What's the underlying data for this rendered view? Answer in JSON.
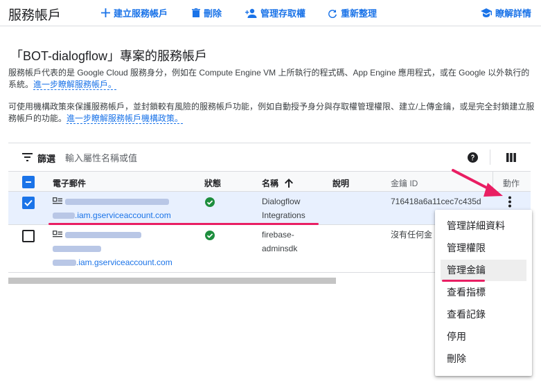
{
  "topbar": {
    "title": "服務帳戶",
    "create_label": "建立服務帳戶",
    "delete_label": "刪除",
    "manage_access_label": "管理存取權",
    "refresh_label": "重新整理",
    "learn_more_label": "瞭解詳情"
  },
  "section": {
    "title": "「BOT-dialogflow」專案的服務帳戶",
    "para1": "服務帳戶代表的是 Google Cloud 服務身分，例如在 Compute Engine VM 上所執行的程式碼、App Engine 應用程式，或在 Google 以外執行的系統。",
    "para1_link": "進一步瞭解服務帳戶。",
    "para2": "可使用機構政策來保護服務帳戶，並封鎖較有風險的服務帳戶功能，例如自動授予身分與存取權管理權限、建立/上傳金鑰，或是完全封鎖建立服務帳戶的功能。",
    "para2_link": "進一步瞭解服務帳戶機構政策。"
  },
  "filter": {
    "label": "篩選",
    "placeholder": "輸入屬性名稱或值"
  },
  "table": {
    "headers": {
      "email": "電子郵件",
      "status": "狀態",
      "name": "名稱",
      "description": "說明",
      "key_id": "金鑰 ID",
      "actions": "動作"
    },
    "rows": [
      {
        "email_suffix": ".iam.gserviceaccount.com",
        "name_line1": "Dialogflow",
        "name_line2": "Integrations",
        "key_id": "716418a6a11cec7c435d",
        "selected": true
      },
      {
        "email_suffix": ".iam.gserviceaccount.com",
        "name_line1": "firebase-",
        "name_line2": "adminsdk",
        "key_id": "沒有任何金",
        "selected": false
      }
    ]
  },
  "menu": {
    "items": [
      "管理詳細資料",
      "管理權限",
      "管理金鑰",
      "查看指標",
      "查看記錄",
      "停用",
      "刪除"
    ],
    "highlighted": "管理金鑰"
  },
  "colors": {
    "accent": "#1a73e8",
    "status_ok": "#1e8e3e",
    "annotation": "#e91e63"
  },
  "icons": {
    "create": "plus-icon",
    "delete": "trash-icon",
    "manage_access": "person-add-icon",
    "refresh": "refresh-icon",
    "learn_more": "school-icon",
    "filter": "filter-icon",
    "help": "help-icon",
    "columns": "column-display-icon",
    "sort": "arrow-up-icon",
    "status": "check-circle-icon",
    "actions": "more-vert-icon",
    "account": "badge-icon"
  }
}
